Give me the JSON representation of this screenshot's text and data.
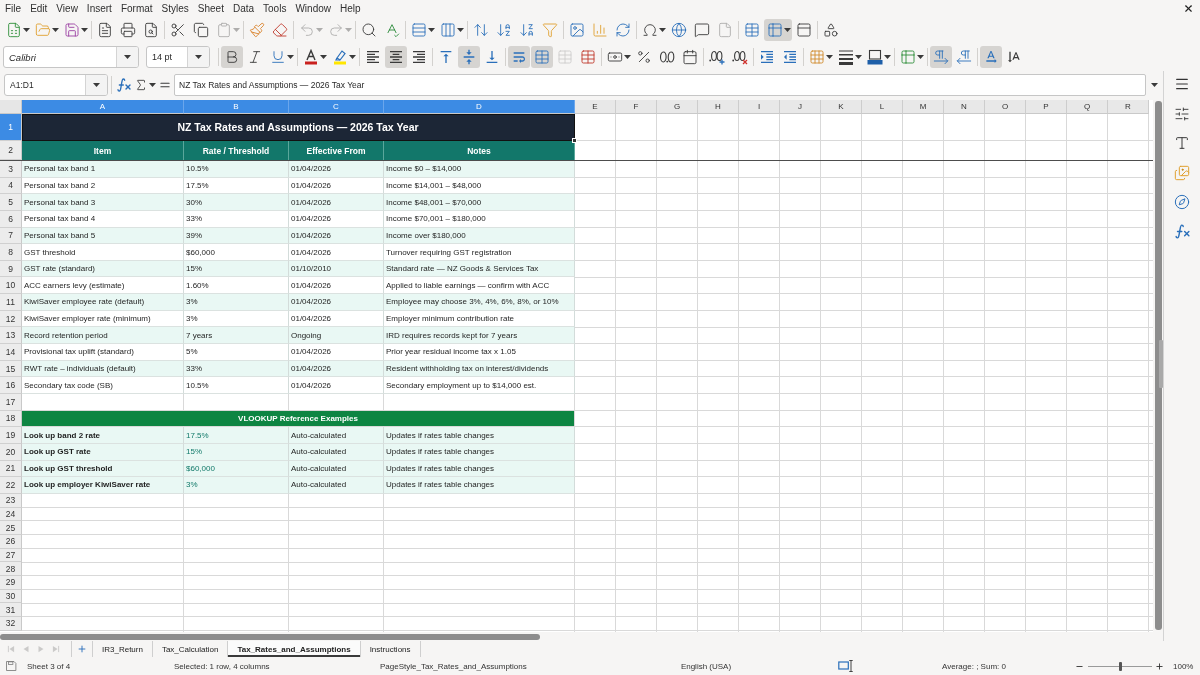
{
  "menu_bar": {
    "items": [
      "File",
      "Edit",
      "View",
      "Insert",
      "Format",
      "Styles",
      "Sheet",
      "Data",
      "Tools",
      "Window",
      "Help"
    ]
  },
  "toolbar_standard": {
    "groups": [
      {
        "buttons": [
          {
            "on": false,
            "disabled": false
          },
          {
            "on": false,
            "disabled": false
          },
          {
            "on": false,
            "disabled": false
          }
        ]
      },
      {
        "buttons": [
          {
            "on": false,
            "disabled": false
          },
          {
            "on": false,
            "disabled": false
          },
          {
            "on": false,
            "disabled": false
          }
        ]
      },
      {
        "buttons": [
          {
            "on": false,
            "disabled": false
          },
          {
            "on": false,
            "disabled": false
          },
          {
            "on": false,
            "disabled": true
          }
        ]
      },
      {
        "buttons": [
          {
            "on": false,
            "disabled": false
          },
          {
            "on": false,
            "disabled": false
          }
        ]
      },
      {
        "buttons": [
          {
            "on": false,
            "disabled": true
          },
          {
            "on": false,
            "disabled": true
          }
        ]
      },
      {
        "buttons": [
          {
            "on": false,
            "disabled": false
          },
          {
            "on": false,
            "disabled": false
          }
        ]
      },
      {
        "buttons": [
          {
            "on": false,
            "disabled": false
          },
          {
            "on": false,
            "disabled": false
          }
        ]
      },
      {
        "buttons": [
          {
            "on": false,
            "disabled": false
          },
          {
            "on": false,
            "disabled": false
          },
          {
            "on": false,
            "disabled": false
          },
          {
            "on": false,
            "disabled": false
          }
        ]
      },
      {
        "buttons": [
          {
            "on": false,
            "disabled": false
          },
          {
            "on": false,
            "disabled": false
          },
          {
            "on": false,
            "disabled": false
          }
        ]
      },
      {
        "buttons": [
          {
            "on": false,
            "disabled": false
          },
          {
            "on": false,
            "disabled": false
          },
          {
            "on": false,
            "disabled": false
          },
          {
            "on": false,
            "disabled": true
          }
        ]
      },
      {
        "buttons": [
          {
            "on": false,
            "disabled": false
          },
          {
            "on": true,
            "disabled": false
          },
          {
            "on": false,
            "disabled": false
          }
        ]
      },
      {
        "buttons": [
          {
            "on": false,
            "disabled": false
          }
        ]
      }
    ]
  },
  "toolbar_formatting": {
    "font_name": "Calibri",
    "font_size": "14 pt",
    "groups": [
      {
        "buttons": [
          {
            "on": true,
            "disabled": false
          },
          {
            "on": false,
            "disabled": false
          },
          {
            "on": false,
            "disabled": false
          }
        ]
      },
      {
        "buttons": [
          {
            "on": false,
            "disabled": false
          },
          {
            "on": false,
            "disabled": false
          }
        ]
      },
      {
        "buttons": [
          {
            "on": false,
            "disabled": false
          },
          {
            "on": true,
            "disabled": false
          },
          {
            "on": false,
            "disabled": false
          }
        ]
      },
      {
        "buttons": [
          {
            "on": false,
            "disabled": false
          },
          {
            "on": true,
            "disabled": false
          },
          {
            "on": false,
            "disabled": false
          }
        ]
      },
      {
        "buttons": [
          {
            "on": true,
            "disabled": false
          },
          {
            "on": true,
            "disabled": false
          },
          {
            "on": false,
            "disabled": true
          },
          {
            "on": false,
            "disabled": false
          }
        ]
      },
      {
        "buttons": [
          {
            "on": false,
            "disabled": false
          },
          {
            "on": false,
            "disabled": false
          },
          {
            "on": false,
            "disabled": false
          },
          {
            "on": false,
            "disabled": false
          }
        ]
      },
      {
        "buttons": [
          {
            "on": false,
            "disabled": false
          },
          {
            "on": false,
            "disabled": false
          }
        ]
      },
      {
        "buttons": [
          {
            "on": false,
            "disabled": false
          },
          {
            "on": false,
            "disabled": false
          }
        ]
      },
      {
        "buttons": [
          {
            "on": false,
            "disabled": false
          },
          {
            "on": false,
            "disabled": false
          },
          {
            "on": false,
            "disabled": false
          }
        ]
      },
      {
        "buttons": [
          {
            "on": false,
            "disabled": false
          }
        ]
      },
      {
        "buttons": [
          {
            "on": true,
            "disabled": false
          },
          {
            "on": false,
            "disabled": false
          }
        ]
      },
      {
        "buttons": [
          {
            "on": true,
            "disabled": false
          },
          {
            "on": false,
            "disabled": false
          }
        ]
      }
    ]
  },
  "formula_bar": {
    "name_box": "A1:D1",
    "formula": "NZ Tax Rates and Assumptions — 2026 Tax Year"
  },
  "sheet": {
    "columns": [
      {
        "label": "A",
        "selected": true
      },
      {
        "label": "B",
        "selected": true
      },
      {
        "label": "C",
        "selected": true
      },
      {
        "label": "D",
        "selected": true
      },
      {
        "label": "E",
        "selected": false
      },
      {
        "label": "F",
        "selected": false
      },
      {
        "label": "G",
        "selected": false
      },
      {
        "label": "H",
        "selected": false
      },
      {
        "label": "I",
        "selected": false
      },
      {
        "label": "J",
        "selected": false
      },
      {
        "label": "K",
        "selected": false
      },
      {
        "label": "L",
        "selected": false
      },
      {
        "label": "M",
        "selected": false
      },
      {
        "label": "N",
        "selected": false
      },
      {
        "label": "O",
        "selected": false
      },
      {
        "label": "P",
        "selected": false
      },
      {
        "label": "Q",
        "selected": false
      },
      {
        "label": "R",
        "selected": false
      }
    ],
    "rows": [
      {
        "number": "1",
        "selected": true,
        "kind": "title",
        "cells": [
          "NZ Tax Rates and Assumptions — 2026 Tax Year"
        ]
      },
      {
        "number": "2",
        "selected": false,
        "kind": "header",
        "cells": [
          "Item",
          "Rate / Threshold",
          "Effective From",
          "Notes"
        ]
      },
      {
        "number": "3",
        "selected": false,
        "kind": "data",
        "shaded": true,
        "cells": [
          "Personal tax band 1",
          "10.5%",
          "01/04/2026",
          "Income $0 – $14,000"
        ]
      },
      {
        "number": "4",
        "selected": false,
        "kind": "data",
        "shaded": false,
        "cells": [
          "Personal tax band 2",
          "17.5%",
          "01/04/2026",
          "Income $14,001 – $48,000"
        ]
      },
      {
        "number": "5",
        "selected": false,
        "kind": "data",
        "shaded": true,
        "cells": [
          "Personal tax band 3",
          "30%",
          "01/04/2026",
          "Income $48,001 – $70,000"
        ]
      },
      {
        "number": "6",
        "selected": false,
        "kind": "data",
        "shaded": false,
        "cells": [
          "Personal tax band 4",
          "33%",
          "01/04/2026",
          "Income $70,001 – $180,000"
        ]
      },
      {
        "number": "7",
        "selected": false,
        "kind": "data",
        "shaded": true,
        "cells": [
          "Personal tax band 5",
          "39%",
          "01/04/2026",
          "Income over $180,000"
        ]
      },
      {
        "number": "8",
        "selected": false,
        "kind": "data",
        "shaded": false,
        "cells": [
          "GST threshold",
          "$60,000",
          "01/04/2026",
          "Turnover requiring GST registration"
        ]
      },
      {
        "number": "9",
        "selected": false,
        "kind": "data",
        "shaded": true,
        "cells": [
          "GST rate (standard)",
          "15%",
          "01/10/2010",
          "Standard rate — NZ Goods & Services Tax"
        ]
      },
      {
        "number": "10",
        "selected": false,
        "kind": "data",
        "shaded": false,
        "cells": [
          "ACC earners levy (estimate)",
          "1.60%",
          "01/04/2026",
          "Applied to liable earnings — confirm with ACC"
        ]
      },
      {
        "number": "11",
        "selected": false,
        "kind": "data",
        "shaded": true,
        "cells": [
          "KiwiSaver employee rate (default)",
          "3%",
          "01/04/2026",
          "Employee may choose 3%, 4%, 6%, 8%, or 10%"
        ]
      },
      {
        "number": "12",
        "selected": false,
        "kind": "data",
        "shaded": false,
        "cells": [
          "KiwiSaver employer rate (minimum)",
          "3%",
          "01/04/2026",
          "Employer minimum contribution rate"
        ]
      },
      {
        "number": "13",
        "selected": false,
        "kind": "data",
        "shaded": true,
        "cells": [
          "Record retention period",
          "7 years",
          "Ongoing",
          "IRD requires records kept for 7 years"
        ]
      },
      {
        "number": "14",
        "selected": false,
        "kind": "data",
        "shaded": false,
        "cells": [
          "Provisional tax uplift (standard)",
          "5%",
          "01/04/2026",
          "Prior year residual income tax x 1.05"
        ]
      },
      {
        "number": "15",
        "selected": false,
        "kind": "data",
        "shaded": true,
        "cells": [
          "RWT rate – individuals (default)",
          "33%",
          "01/04/2026",
          "Resident withholding tax on interest/dividends"
        ]
      },
      {
        "number": "16",
        "selected": false,
        "kind": "data",
        "shaded": false,
        "cells": [
          "Secondary tax code (SB)",
          "10.5%",
          "01/04/2026",
          "Secondary employment up to $14,000 est."
        ]
      },
      {
        "number": "17",
        "selected": false,
        "kind": "empty"
      },
      {
        "number": "18",
        "selected": false,
        "kind": "section",
        "cells": [
          "VLOOKUP Reference Examples"
        ]
      },
      {
        "number": "19",
        "selected": false,
        "kind": "lookup",
        "shaded": true,
        "cells": [
          "Look up band 2 rate",
          "17.5%",
          "Auto-calculated",
          "Updates if rates table changes"
        ]
      },
      {
        "number": "20",
        "selected": false,
        "kind": "lookup",
        "shaded": true,
        "cells": [
          "Look up GST rate",
          "15%",
          "Auto-calculated",
          "Updates if rates table changes"
        ]
      },
      {
        "number": "21",
        "selected": false,
        "kind": "lookup",
        "shaded": true,
        "cells": [
          "Look up GST threshold",
          "$60,000",
          "Auto-calculated",
          "Updates if rates table changes"
        ]
      },
      {
        "number": "22",
        "selected": false,
        "kind": "lookup",
        "shaded": true,
        "cells": [
          "Look up employer KiwiSaver rate",
          "3%",
          "Auto-calculated",
          "Updates if rates table changes"
        ]
      },
      {
        "number": "23",
        "selected": false,
        "kind": "empty"
      },
      {
        "number": "24",
        "selected": false,
        "kind": "empty"
      },
      {
        "number": "25",
        "selected": false,
        "kind": "empty"
      },
      {
        "number": "26",
        "selected": false,
        "kind": "empty"
      },
      {
        "number": "27",
        "selected": false,
        "kind": "empty"
      },
      {
        "number": "28",
        "selected": false,
        "kind": "empty"
      },
      {
        "number": "29",
        "selected": false,
        "kind": "empty"
      },
      {
        "number": "30",
        "selected": false,
        "kind": "empty"
      },
      {
        "number": "31",
        "selected": false,
        "kind": "empty"
      },
      {
        "number": "32",
        "selected": false,
        "kind": "empty"
      }
    ]
  },
  "sheet_nav": [
    {
      "disabled": true
    },
    {
      "disabled": true
    },
    {
      "disabled": true
    },
    {
      "disabled": true
    }
  ],
  "sheet_tabs": [
    {
      "label": "IR3_Return",
      "selected": false
    },
    {
      "label": "Tax_Calculation",
      "selected": false
    },
    {
      "label": "Tax_Rates_and_Assumptions",
      "selected": true
    },
    {
      "label": "Instructions",
      "selected": false
    }
  ],
  "status_bar": {
    "sheet_count": "Sheet 3 of 4",
    "selection": "Selected: 1 row, 4 columns",
    "page_style": "PageStyle_Tax_Rates_and_Assumptions",
    "language": "English (USA)",
    "summary": "Average: ; Sum: 0",
    "zoom": {
      "level": 0.5,
      "reading": "100%"
    }
  }
}
